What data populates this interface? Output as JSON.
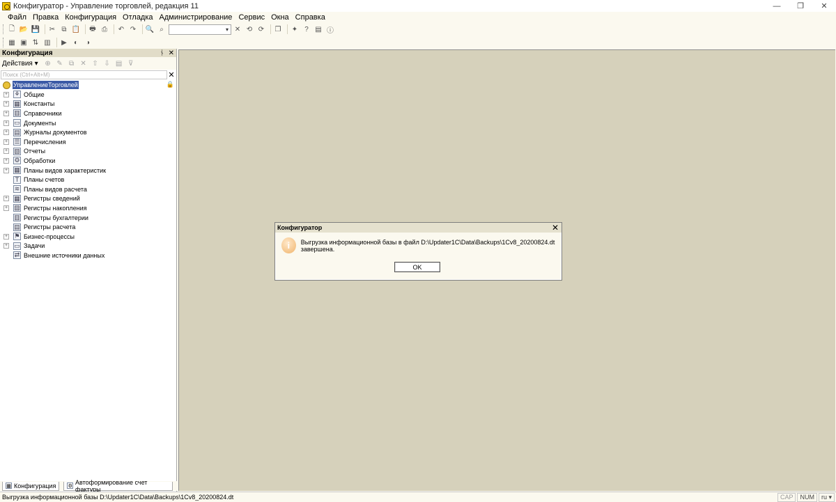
{
  "window": {
    "title": "Конфигуратор - Управление торговлей, редакция 11",
    "controls": {
      "minimize": "—",
      "restore": "❐",
      "close": "✕"
    }
  },
  "menu": [
    "Файл",
    "Правка",
    "Конфигурация",
    "Отладка",
    "Администрирование",
    "Сервис",
    "Окна",
    "Справка"
  ],
  "toolbar": {
    "search_value": "",
    "search_dropdown": "▾",
    "search_clear": "✕"
  },
  "left_panel": {
    "title": "Конфигурация",
    "pin": "ᚾ",
    "close": "✕",
    "actions_label": "Действия ▾",
    "search_placeholder": "Поиск (Ctrl+Alt+M)",
    "search_clear": "✕",
    "root": "УправлениеТорговлей",
    "items": [
      {
        "label": "Общие",
        "icon": "common-icon",
        "expandable": true
      },
      {
        "label": "Константы",
        "icon": "constants-icon",
        "expandable": true
      },
      {
        "label": "Справочники",
        "icon": "catalogs-icon",
        "expandable": true
      },
      {
        "label": "Документы",
        "icon": "documents-icon",
        "expandable": true
      },
      {
        "label": "Журналы документов",
        "icon": "journals-icon",
        "expandable": true
      },
      {
        "label": "Перечисления",
        "icon": "enums-icon",
        "expandable": true
      },
      {
        "label": "Отчеты",
        "icon": "reports-icon",
        "expandable": true
      },
      {
        "label": "Обработки",
        "icon": "processing-icon",
        "expandable": true
      },
      {
        "label": "Планы видов характеристик",
        "icon": "char-types-icon",
        "expandable": true
      },
      {
        "label": "Планы счетов",
        "icon": "accounts-chart-icon",
        "expandable": false
      },
      {
        "label": "Планы видов расчета",
        "icon": "calc-types-icon",
        "expandable": false
      },
      {
        "label": "Регистры сведений",
        "icon": "info-registers-icon",
        "expandable": true
      },
      {
        "label": "Регистры накопления",
        "icon": "accum-registers-icon",
        "expandable": true
      },
      {
        "label": "Регистры бухгалтерии",
        "icon": "accounting-registers-icon",
        "expandable": false
      },
      {
        "label": "Регистры расчета",
        "icon": "calc-registers-icon",
        "expandable": false
      },
      {
        "label": "Бизнес-процессы",
        "icon": "business-processes-icon",
        "expandable": true
      },
      {
        "label": "Задачи",
        "icon": "tasks-icon",
        "expandable": true
      },
      {
        "label": "Внешние источники данных",
        "icon": "external-sources-icon",
        "expandable": false
      }
    ]
  },
  "tabs": [
    {
      "label": "Конфигурация"
    },
    {
      "label": "Автоформирование счет фактуры"
    }
  ],
  "dialog": {
    "title": "Конфигуратор",
    "close": "✕",
    "icon": "i",
    "message": "Выгрузка информационной базы в файл D:\\Updater1C\\Data\\Backups\\1Cv8_20200824.dt завершена.",
    "ok_label": "OK"
  },
  "status": {
    "text": "Выгрузка информационной базы D:\\Updater1C\\Data\\Backups\\1Cv8_20200824.dt",
    "cap": "CAP",
    "num": "NUM",
    "lang": "ru ▾"
  }
}
